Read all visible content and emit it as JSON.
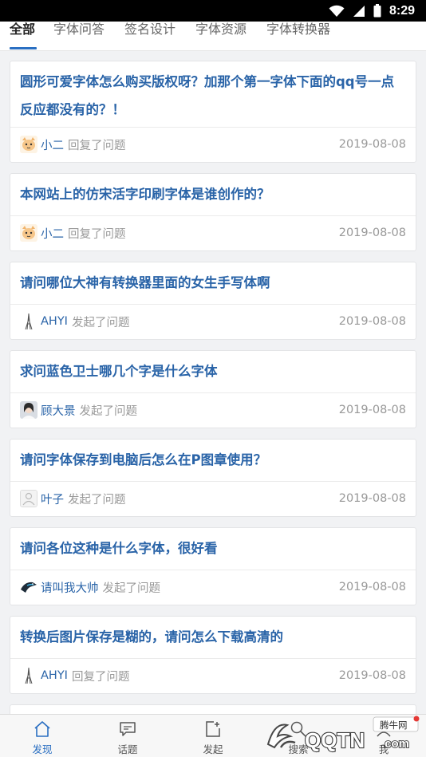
{
  "status": {
    "time": "8:29"
  },
  "tabs": [
    {
      "label": "全部",
      "active": true
    },
    {
      "label": "字体问答"
    },
    {
      "label": "签名设计"
    },
    {
      "label": "字体资源"
    },
    {
      "label": "字体转换器"
    }
  ],
  "cards": [
    {
      "title": "圆形可爱字体怎么购买版权呀？加那个第一字体下面的qq号一点反应都没有的？！",
      "user": "小二",
      "action": "回复了问题",
      "date": "2019-08-08",
      "avatar": "cat"
    },
    {
      "title": "本网站上的仿宋活字印刷字体是谁创作的？",
      "user": "小二",
      "action": "回复了问题",
      "date": "2019-08-08",
      "avatar": "cat"
    },
    {
      "title": "请问哪位大神有转换器里面的女生手写体啊",
      "user": "AHYI",
      "action": "发起了问题",
      "date": "2019-08-08",
      "avatar": "tower"
    },
    {
      "title": "求问蓝色卫士哪几个字是什么字体",
      "user": "顾大景",
      "action": "发起了问题",
      "date": "2019-08-08",
      "avatar": "portrait"
    },
    {
      "title": "请问字体保存到电脑后怎么在P图章使用？",
      "user": "叶子",
      "action": "发起了问题",
      "date": "2019-08-08",
      "avatar": "default"
    },
    {
      "title": "请问各位这种是什么字体，很好看",
      "user": "请叫我大帅",
      "action": "发起了问题",
      "date": "2019-08-08",
      "avatar": "bird"
    },
    {
      "title": "转换后图片保存是糊的，请问怎么下载高清的",
      "user": "AHYI",
      "action": "回复了问题",
      "date": "2019-08-08",
      "avatar": "tower"
    }
  ],
  "nav": [
    {
      "label": "发现",
      "icon": "home-icon",
      "active": true
    },
    {
      "label": "话题",
      "icon": "chat-icon"
    },
    {
      "label": "发起",
      "icon": "compose-icon"
    },
    {
      "label": "搜索",
      "icon": "search-icon"
    },
    {
      "label": "我",
      "icon": "user-icon"
    }
  ],
  "watermark": {
    "brand": "QQTN.com",
    "site": "腾牛网"
  },
  "colors": {
    "accent": "#2a6fc2",
    "title": "#2a64a8",
    "meta": "#999999",
    "background": "#f1f2f4"
  }
}
